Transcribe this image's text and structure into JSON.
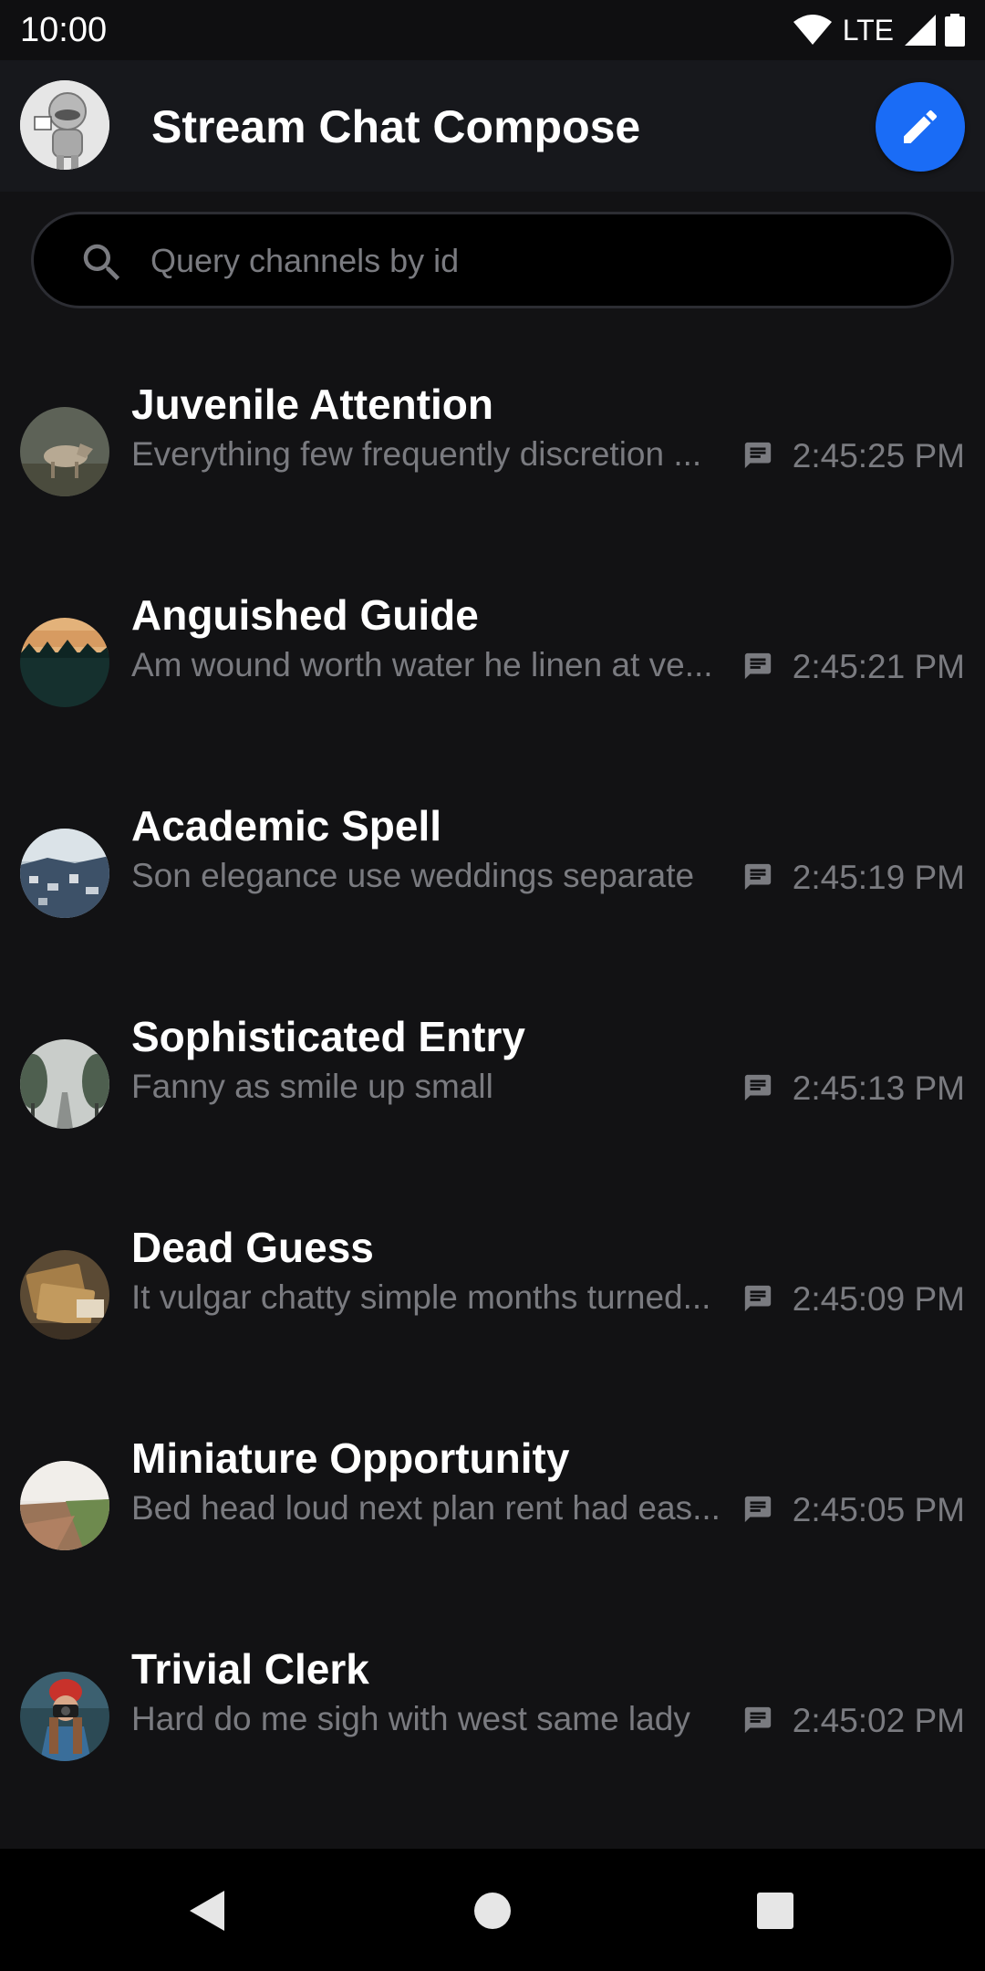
{
  "status_bar": {
    "time": "10:00",
    "network": "LTE",
    "icons": [
      "wifi-icon",
      "cell-signal-icon",
      "battery-icon"
    ]
  },
  "app_bar": {
    "title": "Stream Chat Compose",
    "avatar_icon": "user-avatar",
    "action_icon": "pencil-icon",
    "accent_color": "#1a6cf6"
  },
  "search": {
    "placeholder": "Query channels by id",
    "value": ""
  },
  "channels": [
    {
      "name": "Juvenile Attention",
      "preview": "Everything few frequently discretion ...",
      "time": "2:45:25 PM",
      "avatar": "wolf-photo"
    },
    {
      "name": "Anguished Guide",
      "preview": "Am wound worth water he linen at ve...",
      "time": "2:45:21 PM",
      "avatar": "forest-sunset-photo"
    },
    {
      "name": "Academic Spell",
      "preview": "Son elegance use weddings separate",
      "time": "2:45:19 PM",
      "avatar": "city-photo"
    },
    {
      "name": "Sophisticated Entry",
      "preview": "Fanny as smile up small",
      "time": "2:45:13 PM",
      "avatar": "tree-road-photo"
    },
    {
      "name": "Dead Guess",
      "preview": "It vulgar chatty simple months turned...",
      "time": "2:45:09 PM",
      "avatar": "books-photo"
    },
    {
      "name": "Miniature Opportunity",
      "preview": "Bed head loud next plan rent had eas...",
      "time": "2:45:05 PM",
      "avatar": "field-photo"
    },
    {
      "name": "Trivial Clerk",
      "preview": "Hard do me sigh with west same lady",
      "time": "2:45:02 PM",
      "avatar": "photographer-photo"
    }
  ],
  "colors": {
    "background": "#121214",
    "app_bar": "#17181c",
    "secondary_text": "#7a7b80",
    "accent": "#1a6cf6"
  },
  "nav_bar": {
    "icons": [
      "back-icon",
      "home-icon",
      "recents-icon"
    ]
  }
}
